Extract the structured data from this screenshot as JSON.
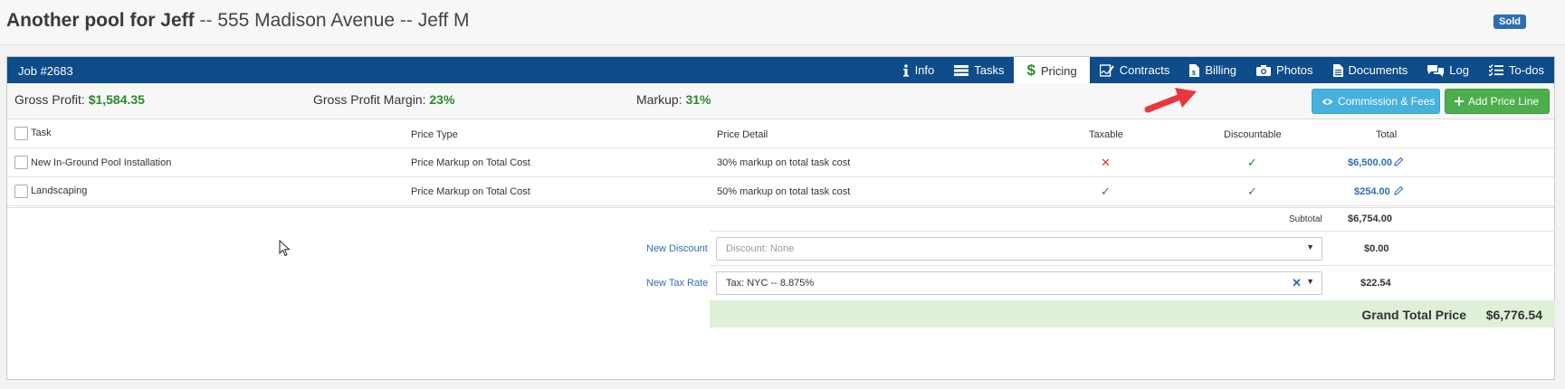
{
  "header": {
    "job_name": "Another pool for Jeff",
    "separator1": " -- ",
    "address": "555 Madison Avenue",
    "separator2": " -- ",
    "customer": "Jeff M",
    "status": "Sold"
  },
  "panel": {
    "job_number": "Job #2683",
    "tabs": [
      {
        "label": "Info",
        "icon": "info-icon"
      },
      {
        "label": "Tasks",
        "icon": "list-icon"
      },
      {
        "label": "Pricing",
        "icon": "dollar-icon",
        "active": true
      },
      {
        "label": "Contracts",
        "icon": "signature-icon"
      },
      {
        "label": "Billing",
        "icon": "invoice-icon"
      },
      {
        "label": "Photos",
        "icon": "camera-icon"
      },
      {
        "label": "Documents",
        "icon": "document-icon"
      },
      {
        "label": "Log",
        "icon": "comments-icon"
      },
      {
        "label": "To-dos",
        "icon": "checklist-icon"
      }
    ]
  },
  "summary": {
    "gross_profit_label": "Gross Profit:",
    "gross_profit_value": "$1,584.35",
    "margin_label": "Gross Profit Margin:",
    "margin_value": "23%",
    "markup_label": "Markup:",
    "markup_value": "31%",
    "commission_button": "Commission & Fees",
    "add_price_line_button": "Add Price Line"
  },
  "table": {
    "columns": {
      "task": "Task",
      "price_type": "Price Type",
      "price_detail": "Price Detail",
      "taxable": "Taxable",
      "discountable": "Discountable",
      "total": "Total"
    },
    "rows": [
      {
        "task": "New In-Ground Pool Installation",
        "price_type": "Price Markup on Total Cost",
        "price_detail": "30% markup on total task cost",
        "taxable": "✕",
        "discountable": "✓",
        "total": "$6,500.00"
      },
      {
        "task": "Landscaping",
        "price_type": "Price Markup on Total Cost",
        "price_detail": "50% markup on total task cost",
        "taxable": "✓",
        "discountable": "✓",
        "total": "$254.00"
      }
    ]
  },
  "totals": {
    "subtotal_label": "Subtotal",
    "subtotal_value": "$6,754.00",
    "discount_label": "New Discount",
    "discount_placeholder": "Discount: None",
    "discount_value": "$0.00",
    "tax_label": "New Tax Rate",
    "tax_selected": "Tax: NYC -- 8.875%",
    "tax_value": "$22.54",
    "grand_total_label": "Grand Total Price",
    "grand_total_value": "$6,776.54"
  },
  "colors": {
    "brand_blue": "#0e4c8a",
    "profit_green": "#2a8a2a",
    "commission_button": "#46b0de",
    "add_button": "#4cae4c",
    "grand_total_bg": "#dff0d8",
    "annotation_arrow": "#e8383d"
  }
}
